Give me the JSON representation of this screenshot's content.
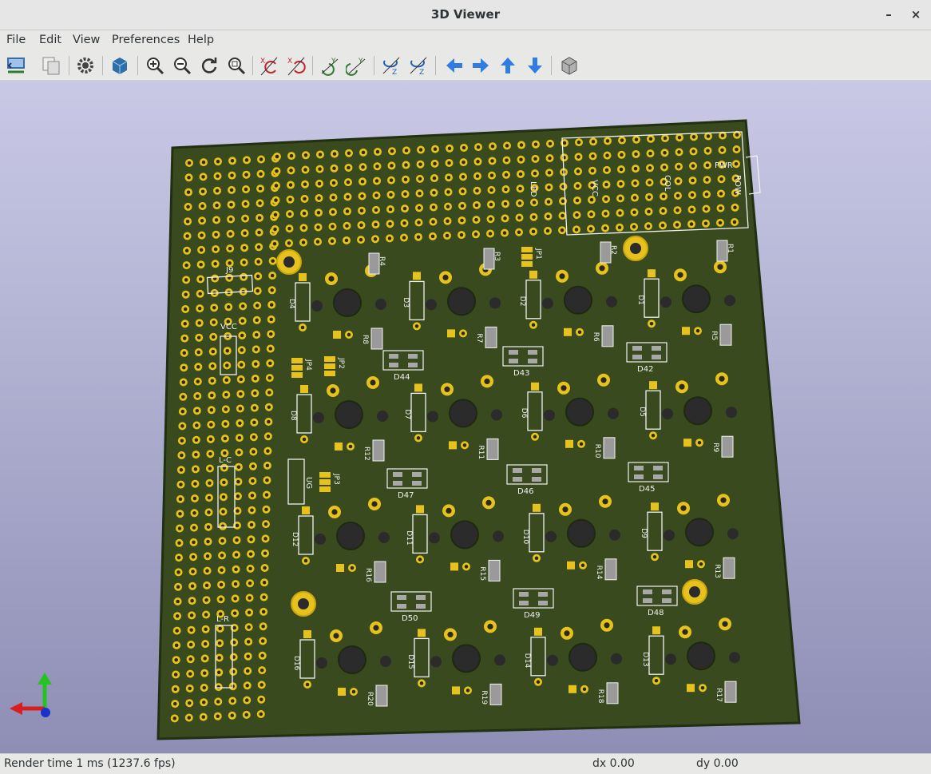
{
  "window": {
    "title": "3D Viewer",
    "minimize_glyph": "–",
    "close_glyph": "×"
  },
  "menu": {
    "file": "File",
    "edit": "Edit",
    "view": "View",
    "preferences": "Preferences",
    "help": "Help"
  },
  "toolbar": {
    "icons": [
      "reload-board-icon",
      "copy-image-icon",
      "settings-gear-icon",
      "raytracing-cube-icon",
      "zoom-in-icon",
      "zoom-out-icon",
      "redraw-icon",
      "zoom-fit-icon",
      "rotate-x-cw-icon",
      "rotate-x-ccw-icon",
      "rotate-y-cw-icon",
      "rotate-y-ccw-icon",
      "rotate-z-cw-icon",
      "rotate-z-ccw-icon",
      "pan-left-icon",
      "pan-right-icon",
      "pan-up-icon",
      "pan-down-icon",
      "ortho-toggle-icon"
    ]
  },
  "colors": {
    "board": "#384a1e",
    "pad": "#e8c21c",
    "silk": "#f2f2f2",
    "background_top": "#c9c9e6",
    "background_bottom": "#8e8eb6"
  },
  "board": {
    "connector_labels": {
      "pwr": "PWR",
      "row": "ROW",
      "col": "COL",
      "vcc_top": "VCC",
      "led": "LED",
      "j9": "J9",
      "vcc_left": "VCC",
      "lc": "L-C",
      "lr": "L-R",
      "ug": "UG"
    },
    "resistors": [
      "R1",
      "R2",
      "R3",
      "R4",
      "R5",
      "R6",
      "R7",
      "R8",
      "R9",
      "R10",
      "R11",
      "R12",
      "R13",
      "R14",
      "R15",
      "R16",
      "R17",
      "R18",
      "R19",
      "R20"
    ],
    "diodes": [
      "D1",
      "D2",
      "D3",
      "D4",
      "D5",
      "D6",
      "D7",
      "D8",
      "D9",
      "D10",
      "D11",
      "D12",
      "D13",
      "D14",
      "D15",
      "D16"
    ],
    "leds": [
      "D42",
      "D43",
      "D44",
      "D45",
      "D46",
      "D47",
      "D48",
      "D49",
      "D50"
    ],
    "jumpers": [
      "JP1",
      "JP2",
      "JP3",
      "JP4"
    ]
  },
  "status": {
    "render_time": "Render time 1 ms (1237.6 fps)",
    "dx": "dx 0.00",
    "dy": "dy 0.00"
  }
}
